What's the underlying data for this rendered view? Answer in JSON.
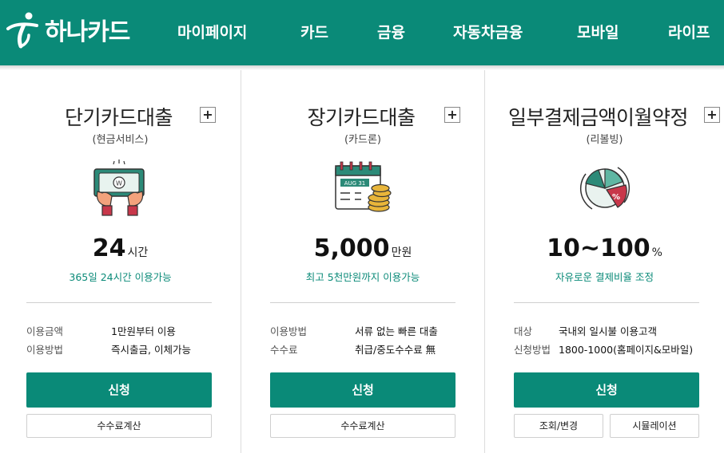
{
  "header": {
    "logo_text": "하나카드",
    "nav": [
      "마이페이지",
      "카드",
      "금융",
      "자동차금융",
      "모바일",
      "라이프"
    ]
  },
  "cards": [
    {
      "title": "단기카드대출",
      "plus": "+",
      "subtitle": "(현금서비스)",
      "illustration_icon": "cash-hands-icon",
      "big_number": "24",
      "big_unit": "시간",
      "note": "365일 24시간 이용가능",
      "info": [
        {
          "label": "이용금액",
          "value": "1만원부터 이용"
        },
        {
          "label": "이용방법",
          "value": "즉시출금, 이체가능"
        }
      ],
      "apply_label": "신청",
      "secondary_buttons": [
        "수수료계산"
      ]
    },
    {
      "title": "장기카드대출",
      "plus": "+",
      "subtitle": "(카드론)",
      "illustration_icon": "calendar-coins-icon",
      "calendar_text": "AUG 31",
      "big_number": "5,000",
      "big_unit": "만원",
      "note": "최고 5천만원까지 이용가능",
      "info": [
        {
          "label": "이용방법",
          "value": "서류 없는 빠른 대출"
        },
        {
          "label": "수수료",
          "value": "취급/중도수수료 無"
        }
      ],
      "apply_label": "신청",
      "secondary_buttons": [
        "수수료계산"
      ]
    },
    {
      "title": "일부결제금액이월약정",
      "plus": "+",
      "subtitle": "(리볼빙)",
      "illustration_icon": "percent-pie-icon",
      "pie_text": "%",
      "big_number": "10~100",
      "big_unit": "%",
      "note": "자유로운 결제비율 조정",
      "info": [
        {
          "label": "대상",
          "value": "국내외 일시불 이용고객"
        },
        {
          "label": "신청방법",
          "value": "1800-1000(홈페이지&모바일)"
        }
      ],
      "apply_label": "신청",
      "secondary_buttons": [
        "조회/변경",
        "시뮬레이션"
      ]
    }
  ],
  "colors": {
    "brand": "#0a8a78",
    "accent_red": "#c8374a",
    "coin": "#e8b53a"
  }
}
